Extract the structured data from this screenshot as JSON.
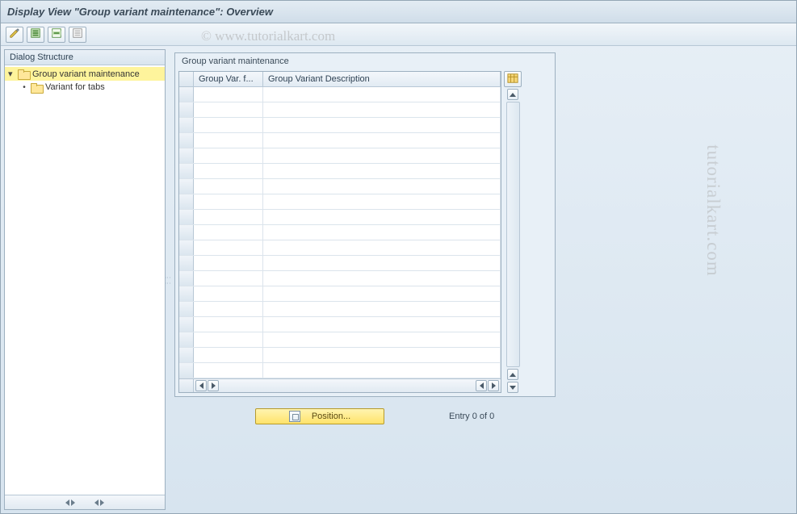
{
  "title": "Display View \"Group variant maintenance\": Overview",
  "watermark_top": "© www.tutorialkart.com",
  "watermark_side": "tutorialkart.com",
  "toolbar": {
    "buttons": [
      {
        "name": "toggle-display-change",
        "icon": "pencil-glasses-icon"
      },
      {
        "name": "select-all",
        "icon": "select-all-icon"
      },
      {
        "name": "select-block",
        "icon": "select-block-icon"
      },
      {
        "name": "deselect-all",
        "icon": "deselect-all-icon"
      }
    ]
  },
  "tree": {
    "header": "Dialog Structure",
    "nodes": [
      {
        "label": "Group variant maintenance",
        "selected": true,
        "level": 0,
        "open": true
      },
      {
        "label": "Variant for tabs",
        "selected": false,
        "level": 1,
        "open": false
      }
    ]
  },
  "grid": {
    "title": "Group variant maintenance",
    "columns": [
      "Group Var. f...",
      "Group Variant Description"
    ],
    "row_count": 19,
    "configure_tooltip": "Configure columns"
  },
  "footer": {
    "position_label": "Position...",
    "entry_text": "Entry 0 of 0"
  }
}
